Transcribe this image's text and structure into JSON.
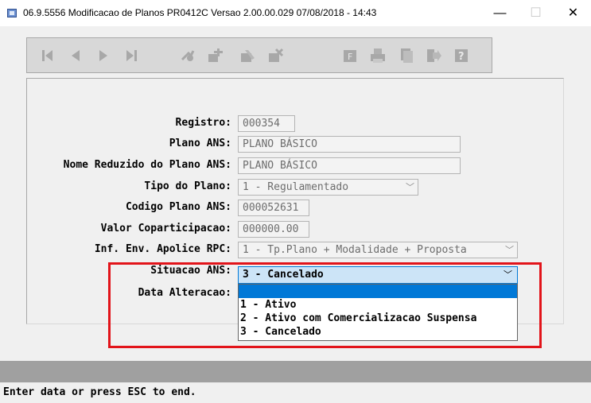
{
  "window": {
    "title": "06.9.5556 Modificacao de Planos PR0412C Versao 2.00.00.029 07/08/2018 - 14:43",
    "minimize_glyph": "—",
    "maximize_glyph": "☐",
    "close_glyph": "✕"
  },
  "toolbar": {
    "buttons": [
      {
        "icon": "first-record-icon"
      },
      {
        "icon": "previous-record-icon"
      },
      {
        "icon": "next-record-icon"
      },
      {
        "icon": "last-record-icon"
      },
      {
        "icon": "goto-icon"
      },
      {
        "icon": "new-icon"
      },
      {
        "icon": "edit-icon"
      },
      {
        "icon": "delete-icon"
      },
      {
        "icon": "filter-icon"
      },
      {
        "icon": "print-icon"
      },
      {
        "icon": "copy-icon"
      },
      {
        "icon": "exit-icon"
      },
      {
        "icon": "help-icon"
      }
    ]
  },
  "form": {
    "registro": {
      "label": "Registro:",
      "value": "000354"
    },
    "plano_ans": {
      "label": "Plano ANS:",
      "value": "PLANO BÁSICO"
    },
    "nome_reduzido": {
      "label": "Nome Reduzido do Plano ANS:",
      "value": "PLANO BÁSICO"
    },
    "tipo_plano": {
      "label": "Tipo do Plano:",
      "value": "1 - Regulamentado"
    },
    "codigo_plano": {
      "label": "Codigo Plano ANS:",
      "value": "000052631"
    },
    "valor_coparticipacao": {
      "label": "Valor Coparticipacao:",
      "value": "000000.00"
    },
    "inf_env": {
      "label": "Inf. Env. Apolice RPC:",
      "value": "1 - Tp.Plano + Modalidade + Proposta"
    },
    "situacao": {
      "label": "Situacao ANS:",
      "value": "3 - Cancelado",
      "options": [
        "1 - Ativo",
        "2 - Ativo com Comercializacao Suspensa",
        "3 - Cancelado"
      ]
    },
    "data_alteracao": {
      "label": "Data Alteracao:"
    }
  },
  "status_text": "Enter data or press ESC to end.",
  "colors": {
    "highlight_border": "#e2141a",
    "selection_blue": "#0078d7",
    "active_field_bg": "#cce4f7",
    "status_bar_gray": "#a0a0a0"
  }
}
